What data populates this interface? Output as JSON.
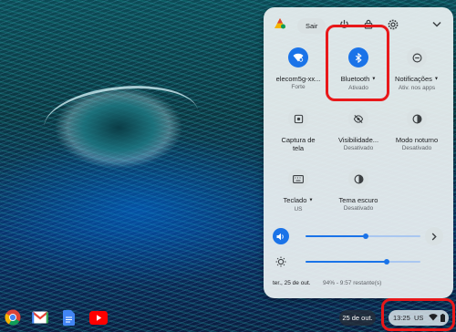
{
  "quick_settings": {
    "signout_label": "Sair",
    "tiles": [
      {
        "label": "elecom5g-xx...",
        "sublabel": "Forte",
        "icon": "wifi-icon",
        "active": true
      },
      {
        "label": "Bluetooth",
        "sublabel": "Ativado",
        "icon": "bluetooth-icon",
        "active": true,
        "has_menu": true
      },
      {
        "label": "Notificações",
        "sublabel": "Ativ. nos apps",
        "icon": "notifications-icon",
        "active": false,
        "has_menu": true
      },
      {
        "label": "Captura de",
        "label2": "tela",
        "sublabel": "",
        "icon": "screen-capture-icon",
        "active": false
      },
      {
        "label": "Visibilidade...",
        "sublabel": "Desativado",
        "icon": "visibility-icon",
        "active": false
      },
      {
        "label": "Modo noturno",
        "sublabel": "Desativado",
        "icon": "night-mode-icon",
        "active": false
      },
      {
        "label": "Teclado",
        "sublabel": "US",
        "icon": "keyboard-icon",
        "active": false,
        "has_menu": true
      },
      {
        "label": "Tema escuro",
        "sublabel": "Desativado",
        "icon": "dark-theme-icon",
        "active": false
      }
    ],
    "volume_level": 0.52,
    "brightness_level": 0.71,
    "footer_date": "ter., 25 de out.",
    "footer_battery": "94% - 9:57 restante(s)"
  },
  "shelf": {
    "apps": [
      "chrome-icon",
      "gmail-icon",
      "docs-icon",
      "youtube-icon"
    ],
    "date": "25 de out.",
    "time": "13:25",
    "language": "US"
  },
  "colors": {
    "accent": "#1a73e8",
    "highlight": "#e8181a",
    "panel_bg": "#ecf1f2"
  }
}
